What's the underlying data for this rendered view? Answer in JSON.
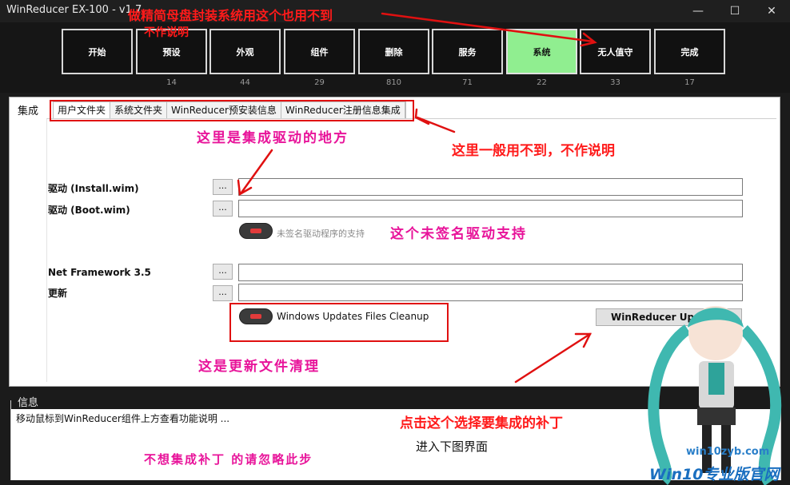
{
  "window": {
    "title": "WinReducer EX-100 - v1.7.",
    "minimize_glyph": "—",
    "maximize_glyph": "☐",
    "close_glyph": "✕"
  },
  "toolbar": {
    "tiles": [
      {
        "label": "开始",
        "count": ""
      },
      {
        "label": "预设",
        "count": "14"
      },
      {
        "label": "外观",
        "count": "44"
      },
      {
        "label": "组件",
        "count": "29"
      },
      {
        "label": "删除",
        "count": "810"
      },
      {
        "label": "服务",
        "count": "71"
      },
      {
        "label": "系统",
        "count": "22"
      },
      {
        "label": "无人值守",
        "count": "33"
      },
      {
        "label": "完成",
        "count": "17"
      }
    ],
    "active_index": 6,
    "active_color": "#90ee90"
  },
  "main": {
    "section_tab": "集成",
    "subtabs": [
      "用户文件夹",
      "系统文件夹",
      "WinReducer预安装信息",
      "WinReducer注册信息集成"
    ],
    "fields": [
      {
        "label": "驱动 (Install.wim)",
        "button": "...",
        "value": ""
      },
      {
        "label": "驱动 (Boot.wim)",
        "button": "...",
        "value": ""
      },
      {
        "label": "Net Framework 3.5",
        "button": "...",
        "value": ""
      },
      {
        "label": "更新",
        "button": "...",
        "value": ""
      }
    ],
    "unsigned_driver_toggle": "未签名驱动程序的支持",
    "cleanup_toggle": "Windows Updates Files Cleanup",
    "update_button": "WinReducer Up"
  },
  "info": {
    "label": "信息",
    "text": "移动鼠标到WinReducer组件上方查看功能说明 ..."
  },
  "annotations": {
    "top": "做精简母盘封装系统用这个也用不到",
    "top2": "不作说明",
    "drivers": "这里是集成驱动的地方",
    "tabs": "这里一般用不到，不作说明",
    "unsigned": "这个未签名驱动支持",
    "cleanup": "这是更新文件清理",
    "patch": "点击这个选择要集成的补丁",
    "next": "进入下图界面",
    "ignore": "不想集成补丁 的请忽略此步"
  },
  "watermark": {
    "site": "win10zyb.com",
    "brand": "Win10专业版官网"
  }
}
